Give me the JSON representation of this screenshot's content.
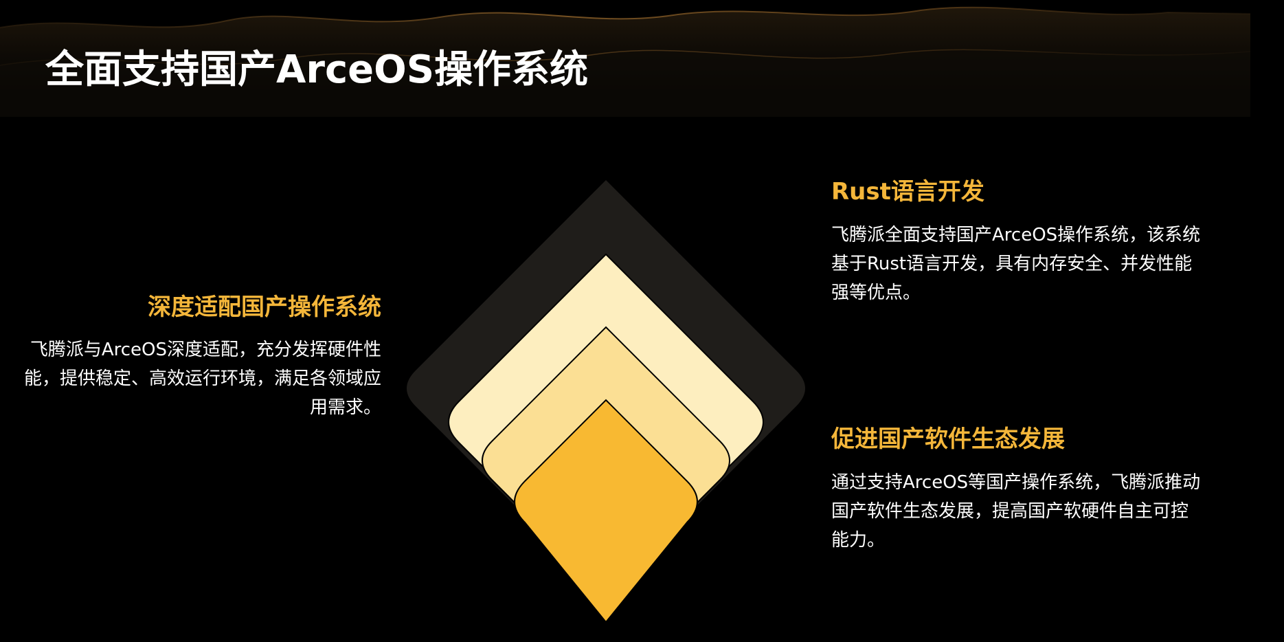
{
  "slide": {
    "title": "全面支持国产ArceOS操作系统"
  },
  "features": {
    "left": {
      "heading": "深度适配国产操作系统",
      "description": "飞腾派与ArceOS深度适配，充分发挥硬件性能，提供稳定、高效运行环境，满足各领域应用需求。"
    },
    "top_right": {
      "heading": "Rust语言开发",
      "description": "飞腾派全面支持国产ArceOS操作系统，该系统基于Rust语言开发，具有内存安全、并发性能强等优点。"
    },
    "bottom_right": {
      "heading": "促进国产软件生态发展",
      "description": "通过支持ArceOS等国产操作系统，飞腾派推动国产软件生态发展，提高国产软硬件自主可控能力。"
    }
  },
  "colors": {
    "background": "#000000",
    "accent_heading": "#f4b63a",
    "layer_outer": "#1f1d1a",
    "layer_light": "#fdeebf",
    "layer_mid": "#fbdf94",
    "layer_inner": "#f8b932",
    "text": "#ffffff"
  }
}
